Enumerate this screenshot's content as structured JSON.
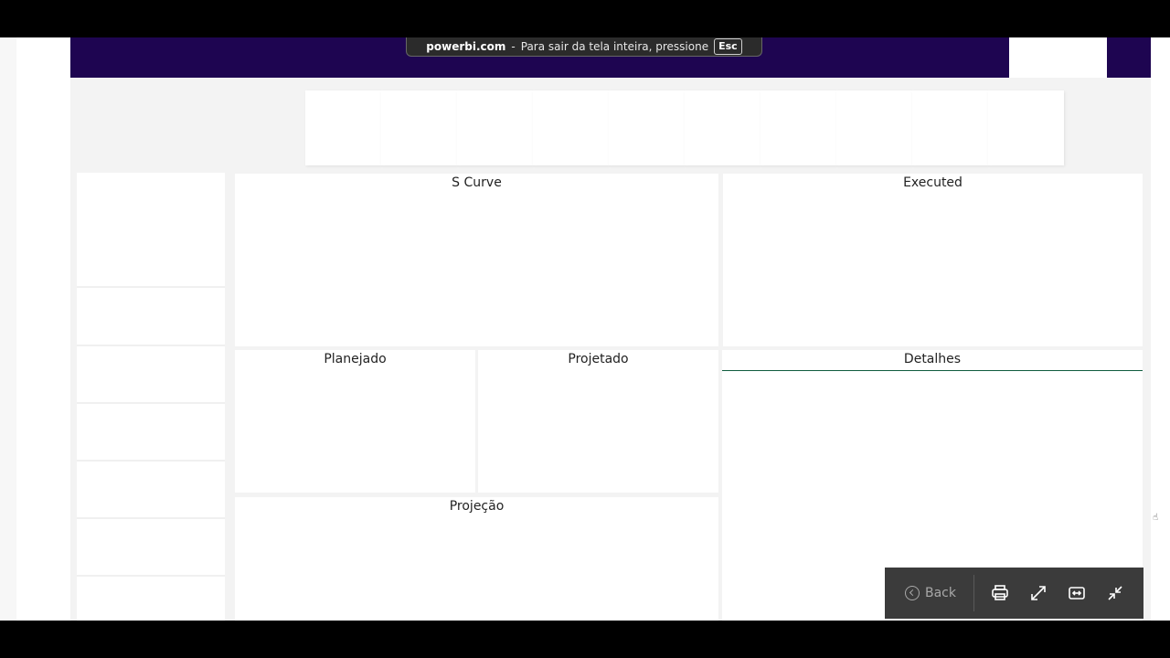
{
  "fullscreen_toast": {
    "domain": "powerbi.com",
    "separator": "-",
    "message": "Para sair da tela inteira, pressione",
    "key": "Esc"
  },
  "panels": {
    "s_curve": "S Curve",
    "executed": "Executed",
    "planejado": "Planejado",
    "projetado": "Projetado",
    "detalhes": "Detalhes",
    "projecao": "Projeção"
  },
  "toolbar": {
    "back_label": "Back",
    "icons": [
      "print-icon",
      "expand-icon",
      "fit-width-icon",
      "exit-fullscreen-icon"
    ]
  },
  "colors": {
    "header": "#1e0551",
    "detalhes_accent": "#0f5c3e",
    "toolbar_bg": "#3b3b3b"
  }
}
